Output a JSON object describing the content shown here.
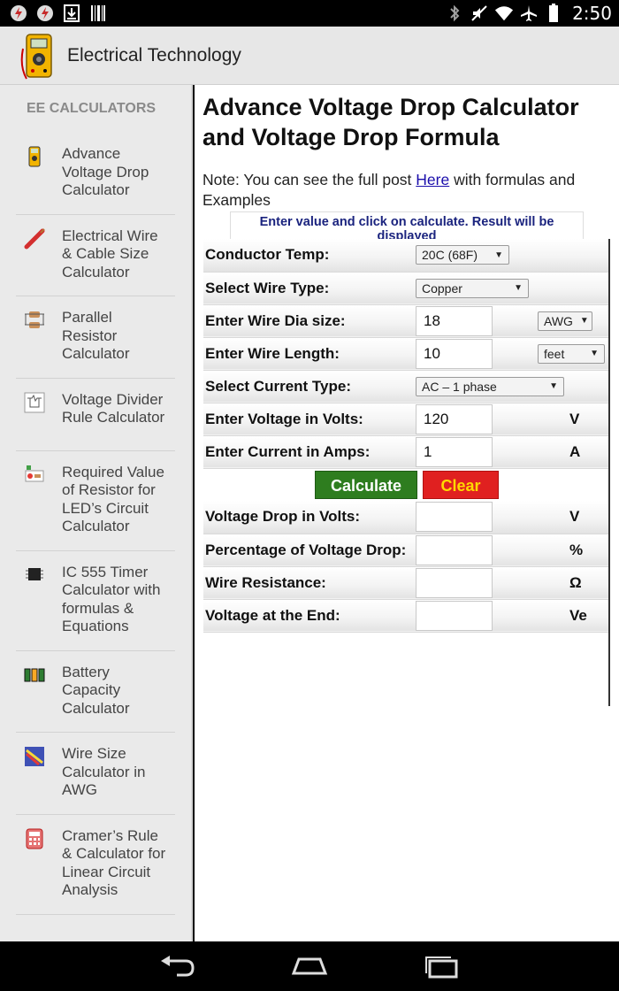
{
  "status_bar": {
    "time": "2:50",
    "left_icons": [
      "app-notification-icon",
      "app-notification-icon",
      "download-icon",
      "barcode-icon"
    ],
    "right_icons": [
      "bluetooth-icon",
      "mute-icon",
      "wifi-icon",
      "airplane-icon",
      "battery-icon"
    ]
  },
  "app_bar": {
    "title": "Electrical Technology",
    "logo_icon": "multimeter-icon"
  },
  "drawer": {
    "header": "EE CALCULATORS",
    "items": [
      {
        "label": "Advance Voltage Drop Calculator",
        "icon": "multimeter-icon"
      },
      {
        "label": "Electrical Wire & Cable Size Calculator",
        "icon": "wire-icon"
      },
      {
        "label": "Parallel Resistor Calculator",
        "icon": "resistor-icon"
      },
      {
        "label": "Voltage Divider Rule Calculator",
        "icon": "circuit-icon"
      },
      {
        "label": "Required Value of Resistor for LED’s Circuit Calculator",
        "icon": "led-circuit-icon"
      },
      {
        "label": "IC 555 Timer Calculator with formulas & Equations",
        "icon": "ic-chip-icon"
      },
      {
        "label": "Battery Capacity Calculator",
        "icon": "battery-cells-icon"
      },
      {
        "label": "Wire Size Calculator in AWG",
        "icon": "wire-gauge-icon"
      },
      {
        "label": "Cramer’s Rule & Calculator for Linear Circuit Analysis",
        "icon": "calculator-icon"
      }
    ]
  },
  "main": {
    "title": "Advance Voltage Drop Calculator and Voltage Drop Formula",
    "note_prefix": "Note: You can see the full post ",
    "note_link": "Here",
    "note_suffix": " with formulas and Examples",
    "info": "Enter value and click on calculate. Result will be displayed"
  },
  "form": {
    "conductor_temp": {
      "label": "Conductor Temp:",
      "value": "20C (68F)"
    },
    "wire_type": {
      "label": "Select Wire Type:",
      "value": "Copper"
    },
    "wire_dia": {
      "label": "Enter Wire Dia size:",
      "value": "18",
      "unit": "AWG"
    },
    "wire_length": {
      "label": "Enter Wire Length:",
      "value": "10",
      "unit": "feet"
    },
    "current_type": {
      "label": "Select Current Type:",
      "value": "AC – 1 phase"
    },
    "voltage": {
      "label": "Enter Voltage in Volts:",
      "value": "120",
      "unit": "V"
    },
    "current": {
      "label": "Enter Current in Amps:",
      "value": "1",
      "unit": "A"
    },
    "calculate_label": "Calculate",
    "clear_label": "Clear",
    "results": [
      {
        "label": "Voltage Drop in Volts:",
        "value": "",
        "unit": "V"
      },
      {
        "label": "Percentage of Voltage Drop:",
        "value": "",
        "unit": "%"
      },
      {
        "label": "Wire Resistance:",
        "value": "",
        "unit": "Ω"
      },
      {
        "label": "Voltage at the End:",
        "value": "",
        "unit": "Ve"
      }
    ]
  },
  "colors": {
    "calculate_button": "#2e7d1f",
    "clear_button": "#e02020",
    "clear_text": "#ffd800",
    "info_text": "#1a237e"
  }
}
